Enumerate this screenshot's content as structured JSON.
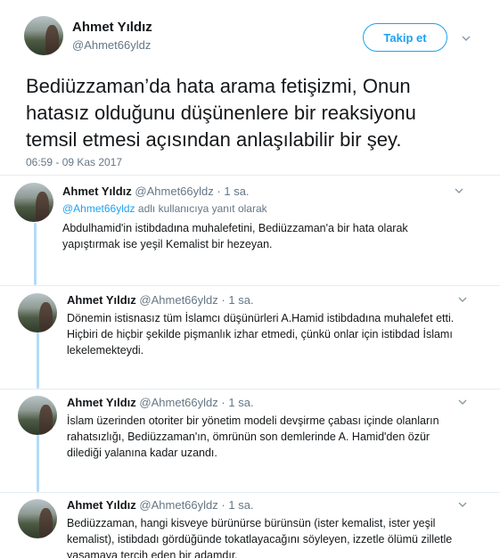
{
  "main_tweet": {
    "author_name": "Ahmet Yıldız",
    "author_handle": "@Ahmet66yldz",
    "follow_label": "Takip et",
    "text": "Bediüzzaman’da hata arama fetişizmi, Onun hatasız olduğunu düşünenlere bir reaksiyonu temsil etmesi açısından anlaşılabilir bir şey.",
    "timestamp": "06:59 - 09 Kas 2017"
  },
  "replies": [
    {
      "name": "Ahmet Yıldız",
      "handle": "@Ahmet66yldz",
      "dot": "·",
      "time": "1 sa.",
      "reply_to_mention": "@Ahmet66yldz",
      "reply_to_suffix": " adlı kullanıcıya yanıt olarak",
      "text": "Abdulhamid'in istibdadına muhalefetini, Bediüzzaman'a bir hata olarak yapıştırmak ise yeşil Kemalist bir hezeyan."
    },
    {
      "name": "Ahmet Yıldız",
      "handle": "@Ahmet66yldz",
      "dot": "·",
      "time": "1 sa.",
      "text": "Dönemin istisnasız  tüm İslamcı düşünürleri A.Hamid istibdadına muhalefet etti. Hiçbiri de hiçbir şekilde pişmanlık izhar etmedi, çünkü onlar için istibdad İslamı lekelemektey­di."
    },
    {
      "name": "Ahmet Yıldız",
      "handle": "@Ahmet66yldz",
      "dot": "·",
      "time": "1 sa.",
      "text": "İslam üzerinden otoriter bir yönetim modeli devşirme çabası içinde olanların rahatsızlığı, Bediüzzaman'ın, ömrünün son demlerinde  A. Hamid'den özür dilediği yalanına kadar uzandı."
    },
    {
      "name": "Ahmet Yıldız",
      "handle": "@Ahmet66yldz",
      "dot": "·",
      "time": "1 sa.",
      "text": "Bediüzzaman, hangi kisveye bürünürse bürünsün (ister kemalist, ister yeşil kemalist), istibdadı gördüğünde tokatlayacağını söyleyen, izzetle ölümü zilletle yaşamaya tercih eden bir adamdır."
    }
  ]
}
